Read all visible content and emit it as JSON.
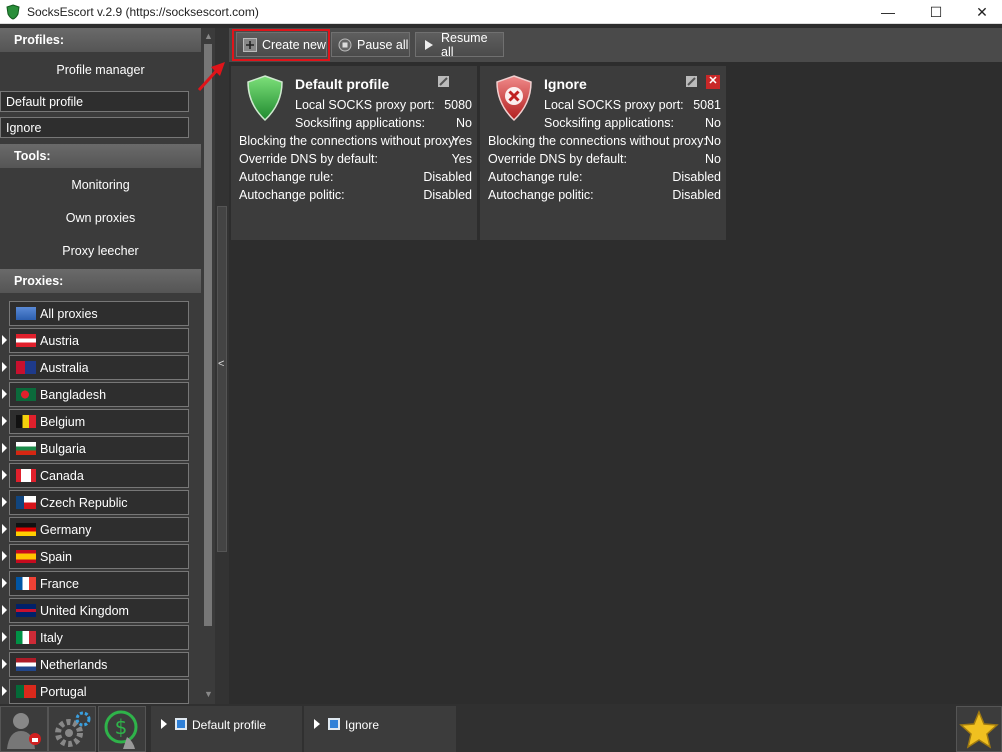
{
  "window": {
    "title": "SocksEscort v.2.9  (https://socksescort.com)",
    "minimize": "—",
    "maximize": "☐",
    "close": "✕"
  },
  "sidebar": {
    "profiles_header": "Profiles:",
    "profile_manager": "Profile manager",
    "profiles": [
      "Default profile",
      "Ignore"
    ],
    "tools_header": "Tools:",
    "tools": [
      "Monitoring",
      "Own proxies",
      "Proxy leecher"
    ],
    "proxies_header": "Proxies:",
    "all_proxies": "All proxies",
    "countries": [
      "Austria",
      "Australia",
      "Bangladesh",
      "Belgium",
      "Bulgaria",
      "Canada",
      "Czech Republic",
      "Germany",
      "Spain",
      "France",
      "United Kingdom",
      "Italy",
      "Netherlands",
      "Portugal"
    ]
  },
  "toolbar": {
    "create_new": "Create new",
    "pause_all": "Pause all",
    "resume_all": "Resume all"
  },
  "cards": [
    {
      "name": "Default profile",
      "status": "protected",
      "port_label": "Local SOCKS proxy port:",
      "port": "5080",
      "socks_label": "Socksifing applications:",
      "socks": "No",
      "block_label": "Blocking the connections without proxy:",
      "block": "Yes",
      "dns_label": "Override DNS by default:",
      "dns": "Yes",
      "rule_label": "Autochange rule:",
      "rule": "Disabled",
      "politic_label": "Autochange politic:",
      "politic": "Disabled"
    },
    {
      "name": "Ignore",
      "status": "ignored",
      "port_label": "Local SOCKS proxy port:",
      "port": "5081",
      "socks_label": "Socksifing applications:",
      "socks": "No",
      "block_label": "Blocking the connections without proxy:",
      "block": "No",
      "dns_label": "Override DNS by default:",
      "dns": "No",
      "rule_label": "Autochange rule:",
      "rule": "Disabled",
      "politic_label": "Autochange politic:",
      "politic": "Disabled"
    }
  ],
  "bottombar": {
    "profiles": [
      "Default profile",
      "Ignore"
    ]
  },
  "colors": {
    "highlight": "#e0141a",
    "shield_green": "#2fb34a",
    "shield_red": "#d03030"
  }
}
